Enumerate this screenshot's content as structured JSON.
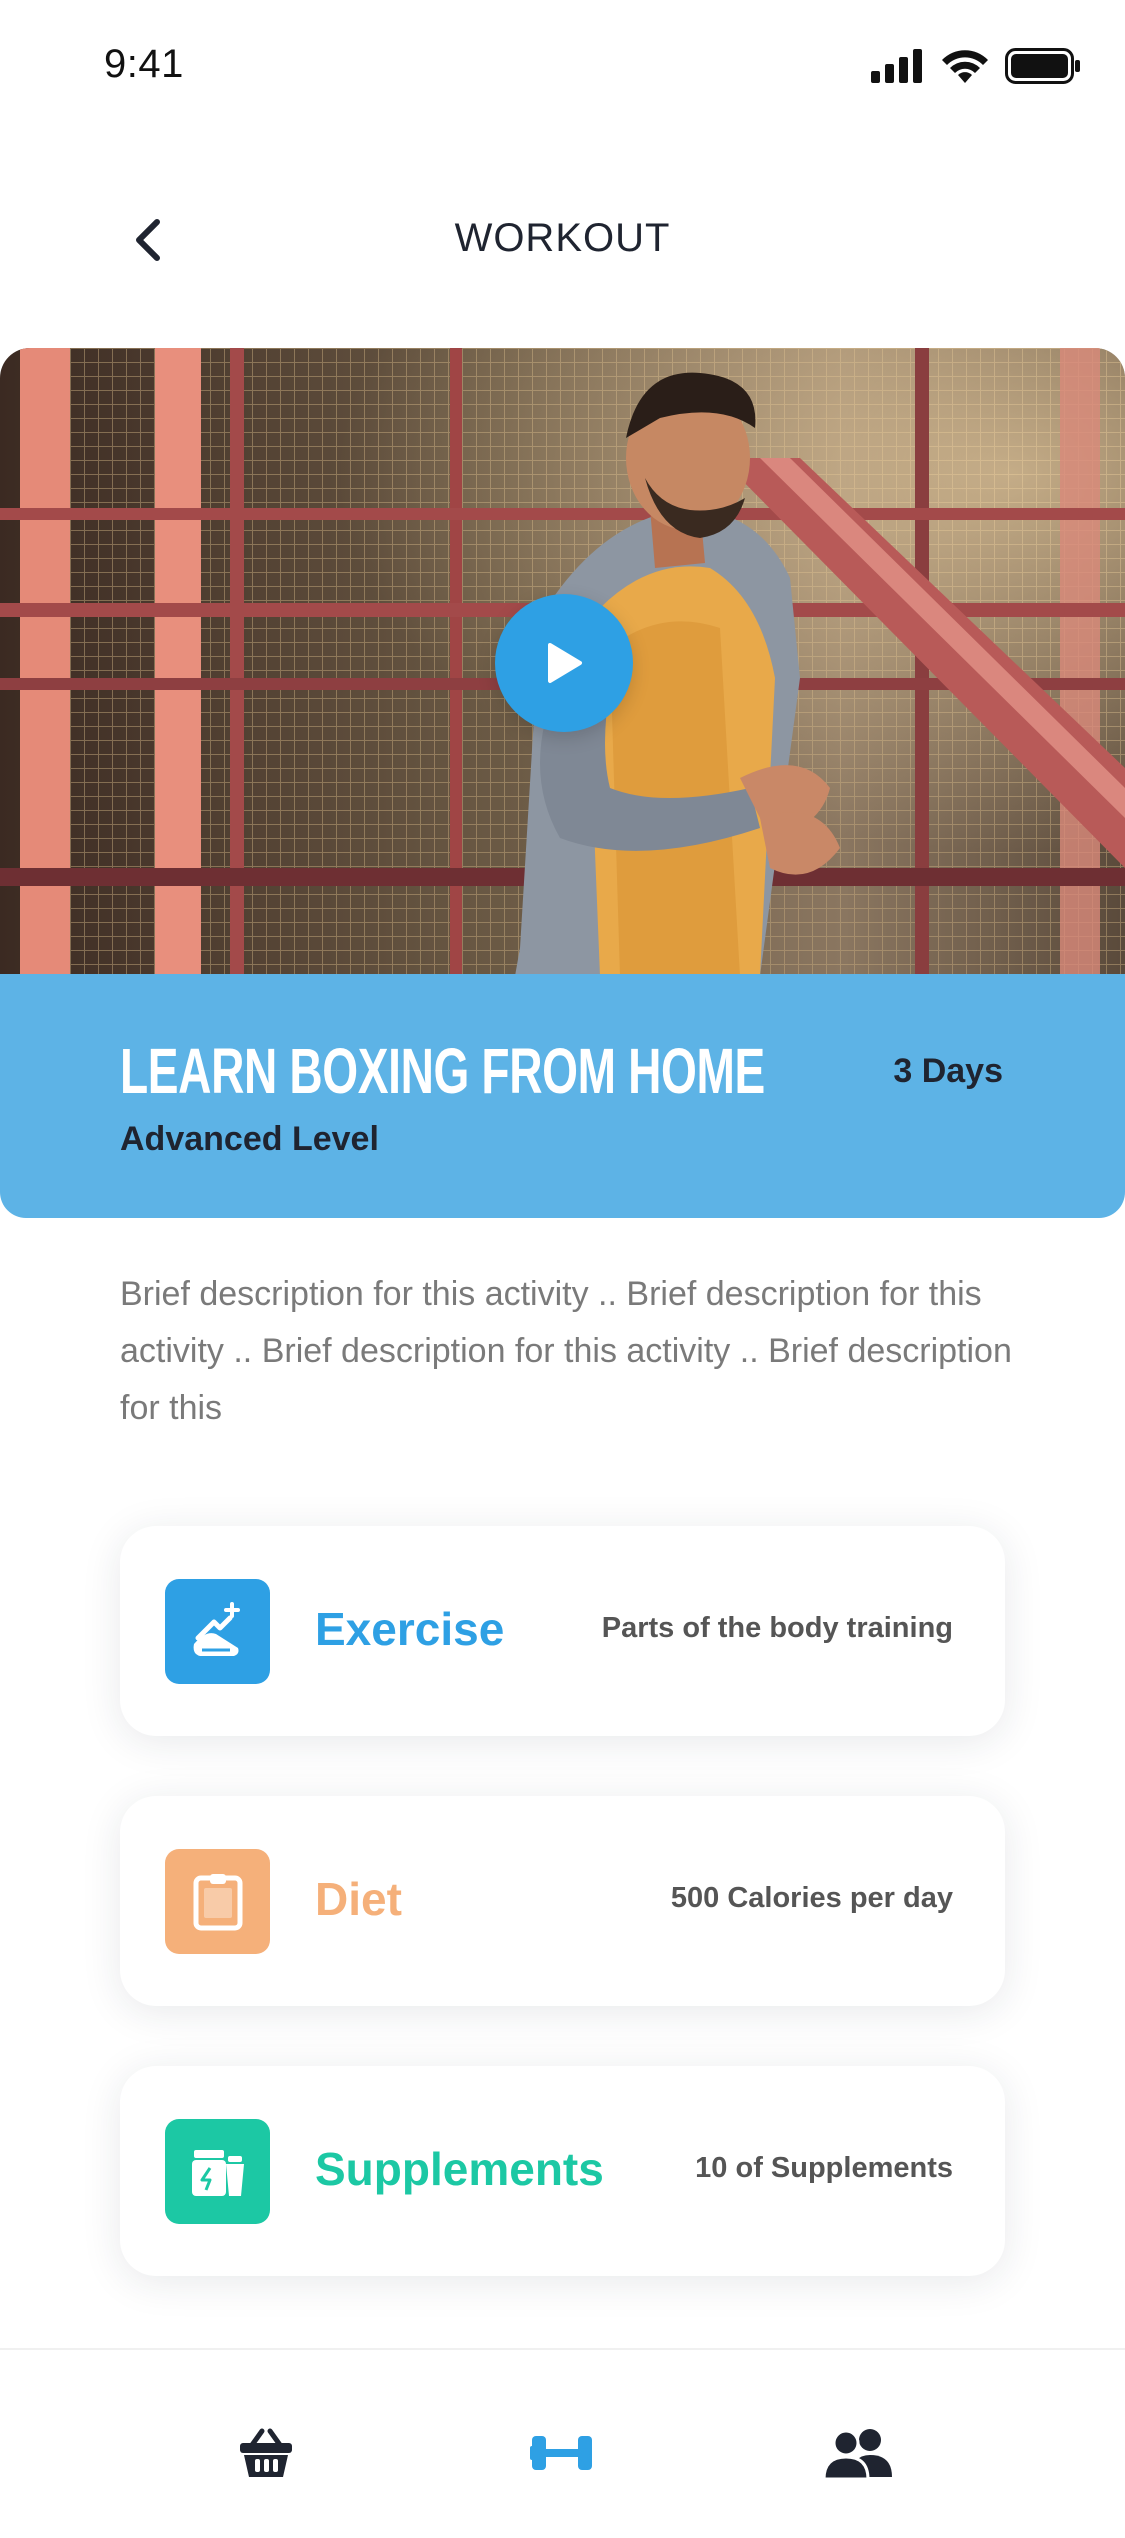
{
  "status_bar": {
    "time": "9:41"
  },
  "header": {
    "title": "WORKOUT"
  },
  "banner": {
    "title": "LEARN BOXING FROM HOME",
    "duration": "3 Days",
    "level": "Advanced Level"
  },
  "description": "Brief description for this activity .. Brief description for this activity .. Brief description for this activity .. Brief description for this",
  "cards": [
    {
      "title": "Exercise",
      "subtitle": "Parts of the body training",
      "icon": "shoe-icon",
      "color": "#2ea0e4"
    },
    {
      "title": "Diet",
      "subtitle": "500 Calories per day",
      "icon": "clipboard-icon",
      "color": "#f5b07a"
    },
    {
      "title": "Supplements",
      "subtitle": "10 of Supplements",
      "icon": "supplements-icon",
      "color": "#1cc8a4"
    }
  ],
  "tab_bar": {
    "items": [
      {
        "icon": "basket-icon",
        "active": false
      },
      {
        "icon": "dumbbell-icon",
        "active": true
      },
      {
        "icon": "users-icon",
        "active": false
      }
    ],
    "active_color": "#2ea0e4",
    "inactive_color": "#1f2430"
  }
}
